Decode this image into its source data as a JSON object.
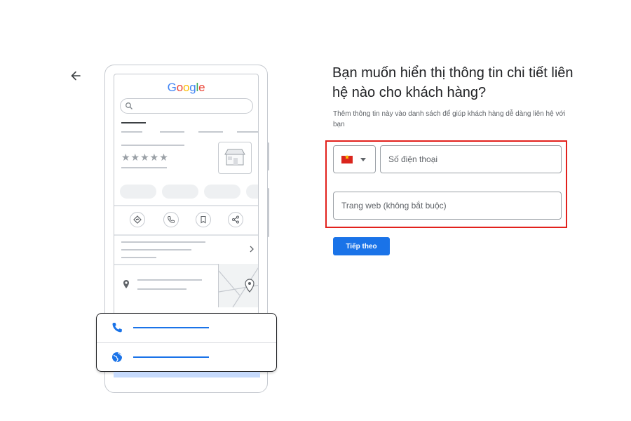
{
  "header": {
    "back_icon": "arrow-left-icon"
  },
  "illustration": {
    "logo_letters": [
      {
        "ch": "G",
        "color": "#4285F4"
      },
      {
        "ch": "o",
        "color": "#EA4335"
      },
      {
        "ch": "o",
        "color": "#FBBC05"
      },
      {
        "ch": "g",
        "color": "#4285F4"
      },
      {
        "ch": "l",
        "color": "#34A853"
      },
      {
        "ch": "e",
        "color": "#EA4335"
      }
    ],
    "rating_stars": "★★★★★",
    "action_icons": [
      "directions-icon",
      "phone-icon",
      "bookmark-icon",
      "share-icon"
    ],
    "card_icons": [
      "phone-icon",
      "globe-icon"
    ],
    "accent_color": "#1a73e8"
  },
  "form": {
    "title": "Bạn muốn hiển thị thông tin chi tiết liên hệ nào cho khách hàng?",
    "subtitle": "Thêm thông tin này vào danh sách để giúp khách hàng dễ dàng liên hệ với bạn",
    "country_selector": {
      "flag": "vietnam-flag-icon",
      "dropdown_icon": "caret-down-icon"
    },
    "phone_placeholder": "Số điện thoại",
    "website_placeholder": "Trang web (không bắt buộc)",
    "next_label": "Tiếp theo",
    "highlight_color": "#e2211c"
  }
}
